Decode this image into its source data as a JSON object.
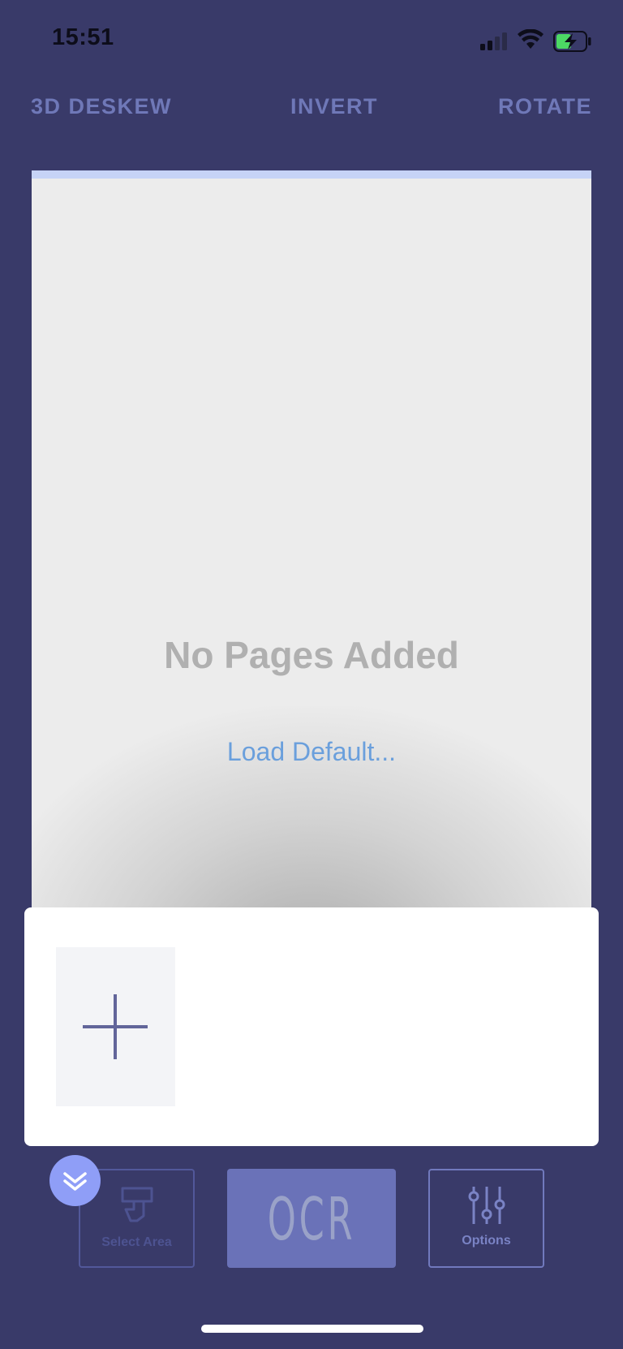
{
  "status_bar": {
    "time": "15:51"
  },
  "toolbar": {
    "deskew_label": "3D DESKEW",
    "invert_label": "INVERT",
    "rotate_label": "ROTATE"
  },
  "preview": {
    "empty_message": "No Pages Added",
    "load_default_label": "Load Default..."
  },
  "bottom_bar": {
    "select_area_label": "Select Area",
    "ocr_label": "OCR",
    "options_label": "Options"
  },
  "colors": {
    "background": "#393a69",
    "accent": "#6f78b8",
    "link": "#6a9fdc",
    "collapse_button": "#8f9ef7"
  },
  "icons": {
    "signal": "signal-icon",
    "wifi": "wifi-icon",
    "battery": "battery-charging-icon",
    "add_page": "plus-icon",
    "collapse": "double-chevron-down-icon",
    "select_area": "crop-select-icon",
    "options": "sliders-icon"
  }
}
